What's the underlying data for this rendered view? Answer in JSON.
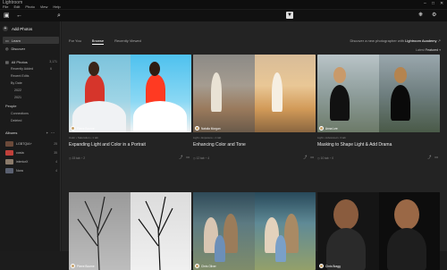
{
  "window": {
    "title": "Lightroom"
  },
  "menu": [
    "File",
    "Edit",
    "Photo",
    "View",
    "Help"
  ],
  "sidebar": {
    "add_photos": "Add Photos",
    "learn": "Learn",
    "discover": "Discover",
    "all_photos": {
      "label": "All Photos",
      "count": "3,171"
    },
    "subs": [
      {
        "label": "Recently Added",
        "count": "6"
      },
      {
        "label": "Recent Edits",
        "count": ""
      },
      {
        "label": "By Date",
        "count": ""
      },
      {
        "label": "2022",
        "count": ""
      },
      {
        "label": "2021",
        "count": ""
      }
    ],
    "people": "People",
    "connections": {
      "label": "Connections",
      "count": ""
    },
    "deleted": {
      "label": "Deleted",
      "count": ""
    },
    "albums_label": "Albums",
    "albums": [
      {
        "label": "LGBTQIA+",
        "count": "25"
      },
      {
        "label": "costa",
        "count": "35"
      },
      {
        "label": "interiorX",
        "count": "4"
      },
      {
        "label": "Nora",
        "count": "4"
      }
    ]
  },
  "main": {
    "tabs": [
      "For You",
      "Browse",
      "Recently Viewed"
    ],
    "active_tab": "Browse",
    "explore_prefix": "Discover a new photographer with",
    "explore_link": "Lightroom Academy",
    "sort_prefix": "Latest",
    "sort_value": "Featured",
    "cards": [
      {
        "author": "Pierre Bourne",
        "tags": "Color • Saturation • 1 tab",
        "title": "Expanding Light and Color in a Portrait",
        "meta": "◷ 15 tab   ◔ 2"
      },
      {
        "author": "Natalia Morgan",
        "tags": "Light • Exposure • 1 tab",
        "title": "Enhancing Color and Tone",
        "meta": "◷ 12 tab   ◔ 4"
      },
      {
        "author": "Anna Lee",
        "tags": "Light • Advanced • 3 tab",
        "title": "Masking to Shape Light & Add Drama",
        "meta": "◷ 10 tab   ◔ 0"
      },
      {
        "author": "Pierre Bourne",
        "tags": "",
        "title": "",
        "meta": ""
      },
      {
        "author": "Chris Oliver",
        "tags": "",
        "title": "",
        "meta": ""
      },
      {
        "author": "Chris Bragg",
        "tags": "",
        "title": "",
        "meta": ""
      }
    ]
  }
}
